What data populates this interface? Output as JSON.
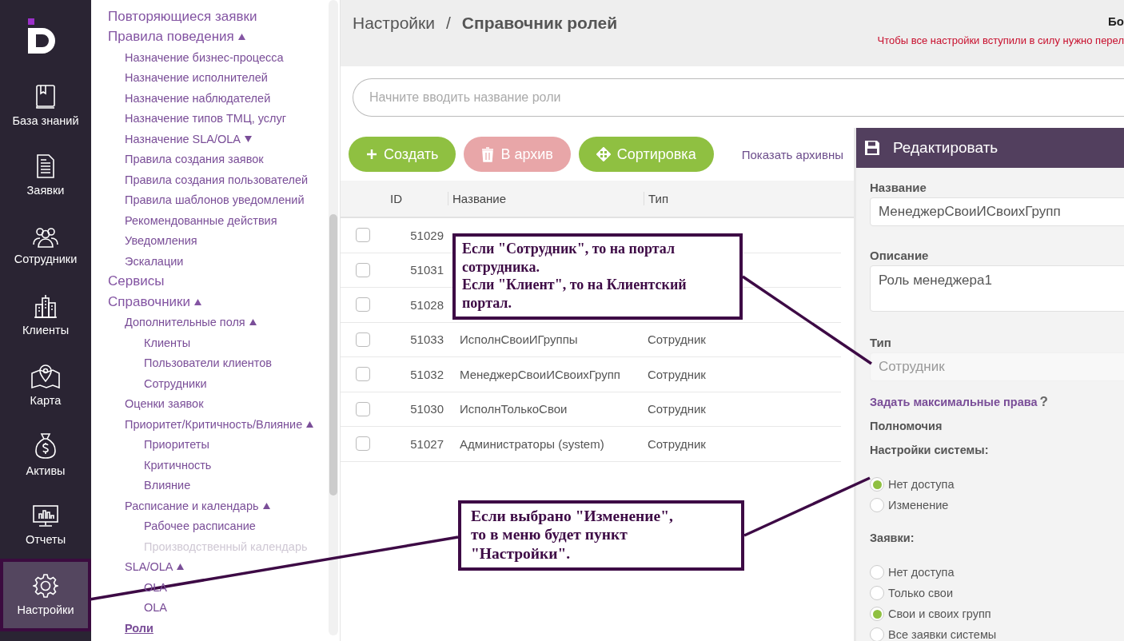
{
  "nav_rail": {
    "items": [
      {
        "label": "База знаний",
        "selected": false
      },
      {
        "label": "Заявки",
        "selected": false
      },
      {
        "label": "Сотрудники",
        "selected": false
      },
      {
        "label": "Клиенты",
        "selected": false
      },
      {
        "label": "Карта",
        "selected": false
      },
      {
        "label": "Активы",
        "selected": false
      },
      {
        "label": "Отчеты",
        "selected": false
      },
      {
        "label": "Настройки",
        "selected": true
      }
    ]
  },
  "sidebar": {
    "items": [
      {
        "label": "Повторяющиеся заявки",
        "selected": false,
        "disabled": false
      },
      {
        "label": "Правила поведения",
        "expanded": true,
        "selected": false,
        "disabled": false,
        "children": [
          {
            "label": "Назначение бизнес-процесса",
            "selected": false,
            "disabled": false
          },
          {
            "label": "Назначение исполнителей",
            "selected": false,
            "disabled": false
          },
          {
            "label": "Назначение наблюдателей",
            "selected": false,
            "disabled": false
          },
          {
            "label": "Назначение типов ТМЦ, услуг",
            "selected": false,
            "disabled": false
          },
          {
            "label": "Назначение SLA/OLA",
            "expanded": false,
            "selected": false,
            "disabled": false
          },
          {
            "label": "Правила создания заявок",
            "selected": false,
            "disabled": false
          },
          {
            "label": "Правила создания пользователей",
            "selected": false,
            "disabled": false
          },
          {
            "label": "Правила шаблонов уведомлений",
            "selected": false,
            "disabled": false
          },
          {
            "label": "Рекомендованные действия",
            "selected": false,
            "disabled": false
          },
          {
            "label": "Уведомления",
            "selected": false,
            "disabled": false
          },
          {
            "label": "Эскалации",
            "selected": false,
            "disabled": false
          }
        ]
      },
      {
        "label": "Сервисы",
        "selected": false,
        "disabled": false
      },
      {
        "label": "Справочники",
        "expanded": true,
        "selected": false,
        "disabled": false,
        "children": [
          {
            "label": "Дополнительные поля",
            "expanded": true,
            "selected": false,
            "disabled": false,
            "children": [
              {
                "label": "Клиенты",
                "selected": false,
                "disabled": false
              },
              {
                "label": "Пользователи клиентов",
                "selected": false,
                "disabled": false
              },
              {
                "label": "Сотрудники",
                "selected": false,
                "disabled": false
              }
            ]
          },
          {
            "label": "Оценки заявок",
            "selected": false,
            "disabled": false
          },
          {
            "label": "Приоритет/Критичность/Влияние",
            "expanded": true,
            "selected": false,
            "disabled": false,
            "children": [
              {
                "label": "Приоритеты",
                "selected": false,
                "disabled": false
              },
              {
                "label": "Критичность",
                "selected": false,
                "disabled": false
              },
              {
                "label": "Влияние",
                "selected": false,
                "disabled": false
              }
            ]
          },
          {
            "label": "Расписание и календарь",
            "expanded": true,
            "selected": false,
            "disabled": false,
            "children": [
              {
                "label": "Рабочее расписание",
                "selected": false,
                "disabled": false
              },
              {
                "label": "Производственный календарь",
                "selected": false,
                "disabled": true
              }
            ]
          },
          {
            "label": "SLA/OLA",
            "expanded": true,
            "selected": false,
            "disabled": false,
            "children": [
              {
                "label": "OLA",
                "selected": false,
                "disabled": false
              },
              {
                "label": "OLA",
                "selected": false,
                "disabled": false
              }
            ]
          },
          {
            "label": "Роли",
            "selected": true,
            "disabled": false
          }
        ]
      }
    ]
  },
  "header": {
    "breadcrumb": [
      "Настройки",
      "/",
      "Справочник ролей"
    ],
    "user": "Бо",
    "warning": "Чтобы все настройки вступили в силу нужно перел"
  },
  "search": {
    "placeholder": "Начните вводить название роли"
  },
  "toolbar": {
    "buttons": [
      {
        "label": "Создать",
        "kind": "create",
        "disabled": false
      },
      {
        "label": "В архив",
        "kind": "archive",
        "disabled": true
      },
      {
        "label": "Сортировка",
        "kind": "sort",
        "disabled": false
      }
    ],
    "link": "Показать архивны"
  },
  "table": {
    "columns": [
      "ID",
      "Название",
      "Тип"
    ],
    "rows": [
      {
        "id": "51029",
        "checked": false
      },
      {
        "id": "51031",
        "checked": false
      },
      {
        "id": "51028",
        "checked": false
      },
      {
        "id": "51033",
        "name": "ИсполнСвоиИГруппы",
        "type": "Сотрудник",
        "checked": false
      },
      {
        "id": "51032",
        "name": "МенеджерСвоиИСвоихГрупп",
        "type": "Сотрудник",
        "checked": false
      },
      {
        "id": "51030",
        "name": "ИсполнТолькоСвои",
        "type": "Сотрудник",
        "checked": false
      },
      {
        "id": "51027",
        "name": "Администраторы (system)",
        "type": "Сотрудник",
        "checked": false
      }
    ]
  },
  "edit_panel": {
    "title": "Редактировать",
    "fields": [
      {
        "label": "Название",
        "value": "МенеджерСвоиИСвоихГрупп",
        "kind": "input",
        "disabled": false
      },
      {
        "label": "Описание",
        "value": "Роль менеджера1",
        "kind": "textarea",
        "disabled": false
      },
      {
        "label": "Тип",
        "value": "Сотрудник",
        "kind": "input",
        "disabled": true
      }
    ],
    "max_rights_link": "Задать максимальные права",
    "help": "?",
    "permissions_title": "Полномочия",
    "groups": [
      {
        "title": "Настройки системы:",
        "options": [
          {
            "label": "Нет доступа",
            "selected": true
          },
          {
            "label": "Изменение",
            "selected": false
          }
        ]
      },
      {
        "title": "Заявки:",
        "options": [
          {
            "label": "Нет доступа",
            "selected": false
          },
          {
            "label": "Только свои",
            "selected": false
          },
          {
            "label": "Свои и своих групп",
            "selected": true
          },
          {
            "label": "Все заявки системы",
            "selected": false
          }
        ]
      }
    ]
  },
  "callouts": [
    {
      "lines": [
        "Если \"Сотрудник\", то на портал",
        "сотрудника.",
        "Если \"Клиент\", то на Клиентский",
        "портал."
      ]
    },
    {
      "lines": [
        "Если выбрано \"Изменение\",",
        "то в меню будет пункт",
        "\"Настройки\"."
      ]
    }
  ]
}
